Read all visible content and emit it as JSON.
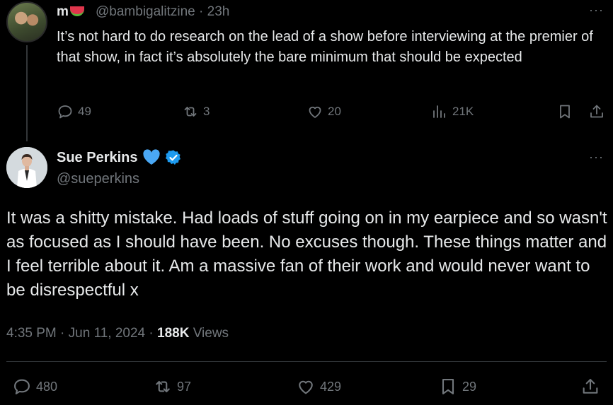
{
  "reply": {
    "display_name": "m",
    "name_emoji": "watermelon",
    "handle": "@bambigalitzine",
    "separator": "·",
    "time": "23h",
    "more": "···",
    "text": "It’s not hard to do research on the lead of a show before interviewing at the premier of that show, in fact it’s absolutely the bare minimum that should be expected",
    "actions": {
      "replies": "49",
      "reposts": "3",
      "likes": "20",
      "views": "21K"
    }
  },
  "tweet": {
    "display_name": "Sue Perkins",
    "handle": "@sueperkins",
    "more": "···",
    "text": "It was a shitty mistake. Had loads of stuff going on in my earpiece and so wasn't as focused as I should have been. No excuses though. These things matter and I feel terrible about it. Am a massive fan of their work and would never want to be disrespectful x",
    "time": "4:35 PM",
    "sep1": "·",
    "date": "Jun 11, 2024",
    "sep2": "·",
    "views_count": "188K",
    "views_label": "Views",
    "actions": {
      "replies": "480",
      "reposts": "97",
      "likes": "429",
      "bookmarks": "29"
    }
  },
  "colors": {
    "background": "#000000",
    "text": "#e7e9ea",
    "muted": "#71767b",
    "verified": "#1d9bf0",
    "heart_emoji": "#4aa8f5"
  }
}
